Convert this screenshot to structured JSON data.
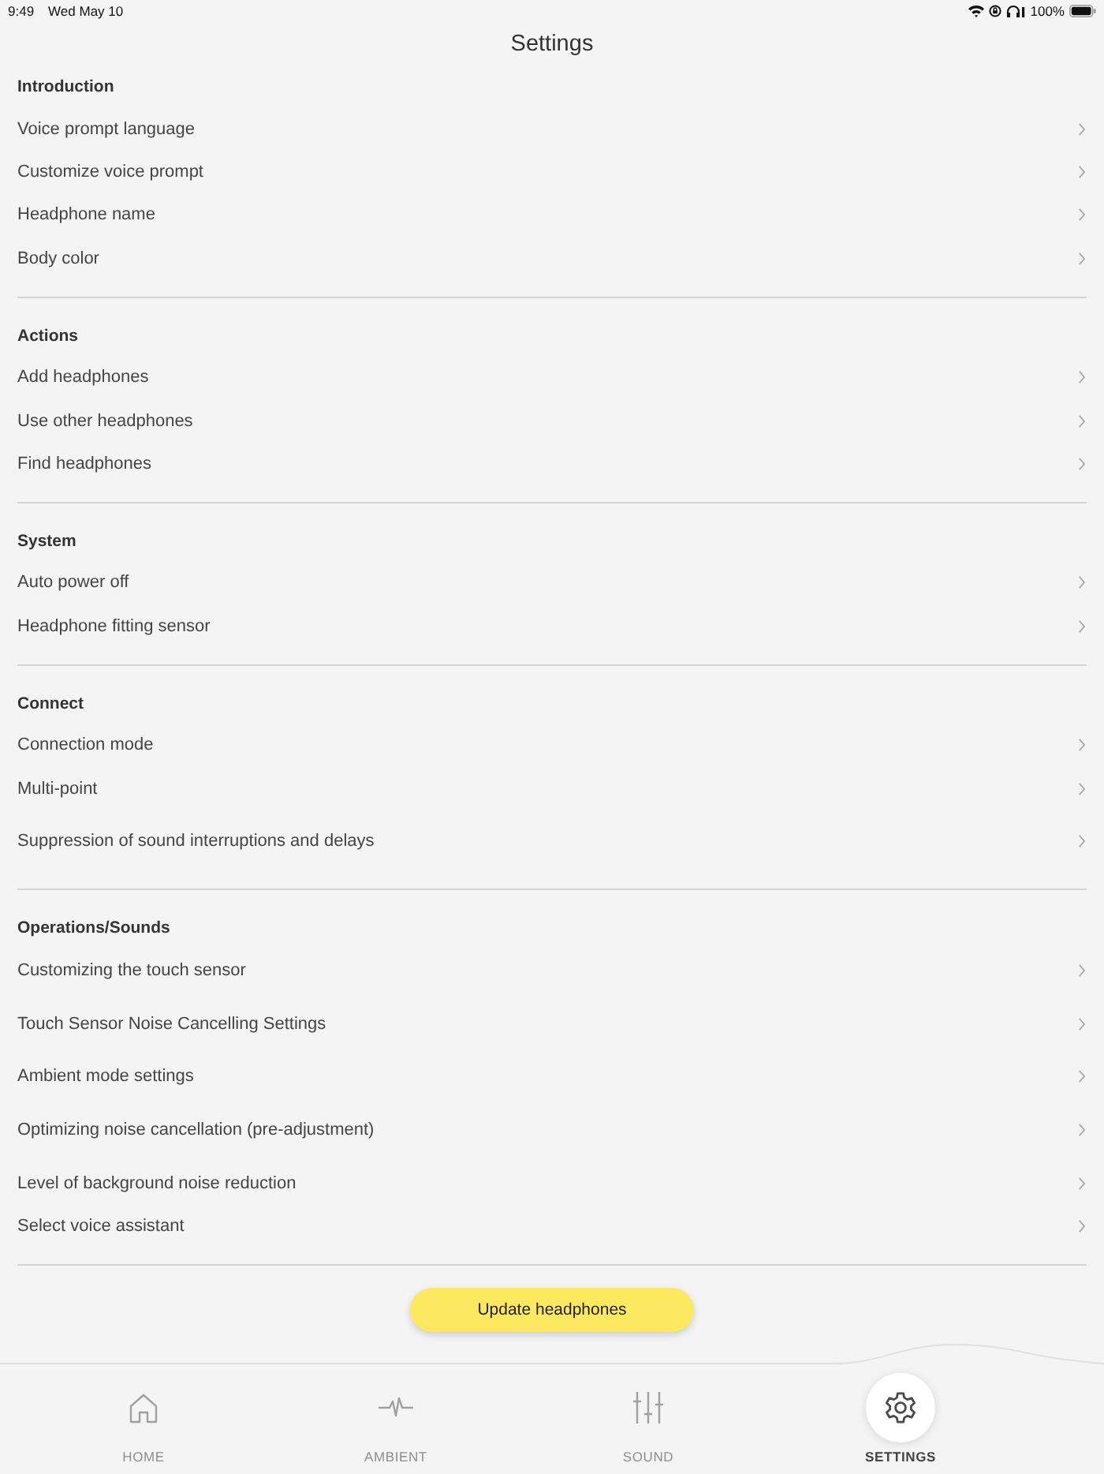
{
  "status_bar": {
    "time": "9:49",
    "date": "Wed May 10",
    "battery": "100%"
  },
  "title": "Settings",
  "sections": [
    {
      "title": "Introduction",
      "items": [
        "Voice prompt language",
        "Customize voice prompt",
        "Headphone name",
        "Body color"
      ]
    },
    {
      "title": "Actions",
      "items": [
        "Add headphones",
        "Use other headphones",
        "Find headphones"
      ]
    },
    {
      "title": "System",
      "items": [
        "Auto power off",
        "Headphone fitting sensor"
      ]
    },
    {
      "title": "Connect",
      "items": [
        "Connection mode",
        "Multi-point",
        "Suppression of sound interruptions and delays"
      ]
    },
    {
      "title": "Operations/Sounds",
      "items": [
        "Customizing the touch sensor",
        "Touch Sensor Noise Cancelling Settings",
        "Ambient mode settings",
        "Optimizing noise cancellation (pre-adjustment)",
        "Level of background noise reduction",
        "Select voice assistant"
      ]
    }
  ],
  "update_button": "Update headphones",
  "tab_bar": [
    {
      "label": "HOME",
      "selected": false
    },
    {
      "label": "AMBIENT",
      "selected": false
    },
    {
      "label": "SOUND",
      "selected": false
    },
    {
      "label": "SETTINGS",
      "selected": true
    }
  ]
}
